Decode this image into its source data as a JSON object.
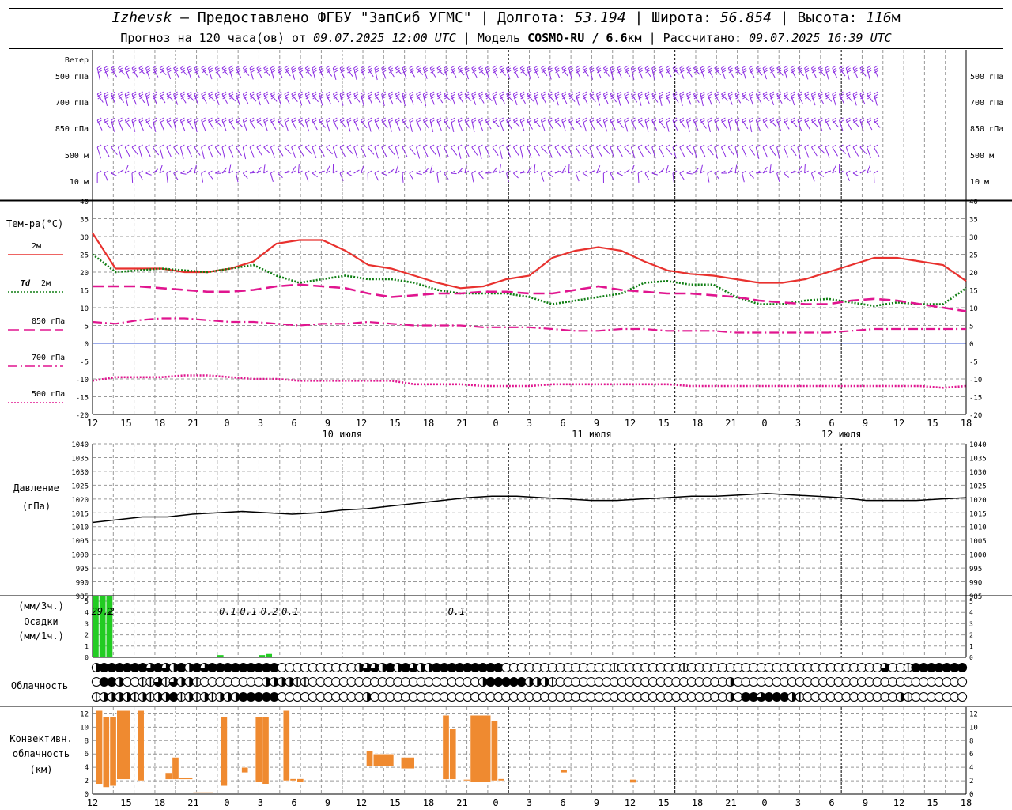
{
  "header": {
    "city": "Izhevsk",
    "provider": " – Предоставлено ФГБУ \"ЗапСиб УГМС\" | Долгота: ",
    "lon": "53.194",
    "lat_label": " | Широта: ",
    "lat": "56.854",
    "alt_label": " | Высота: ",
    "alt": "116",
    "alt_unit": "м",
    "line2_a": "Прогноз на 120 часа(ов) от ",
    "run": "09.07.2025 12:00 UTC",
    "line2_b": " | Модель ",
    "model": "COSMO-RU / 6.6",
    "model_unit": "км",
    "line2_c": " | Рассчитано: ",
    "calc": "09.07.2025 16:39 UTC"
  },
  "chart_data": [
    {
      "type": "wind-barbs",
      "title": "Ветер",
      "levels": [
        "500 гПа",
        "700 гПа",
        "850 гПа",
        "500 м",
        "10 м"
      ]
    },
    {
      "type": "line",
      "title": "Тем-ра(°C)",
      "x_hours_from_start": [
        0,
        3,
        6,
        9,
        12,
        15,
        18,
        21,
        24,
        27,
        30,
        33,
        36,
        39,
        42,
        45,
        48,
        51,
        54,
        57,
        60,
        63,
        66,
        69,
        72,
        75,
        78,
        81,
        84,
        87,
        90,
        93,
        96,
        99,
        102,
        105,
        108,
        111,
        114,
        117,
        120,
        123,
        126
      ],
      "ylim": [
        -20,
        40
      ],
      "yticks": [
        -20,
        -15,
        -10,
        -5,
        0,
        5,
        10,
        15,
        20,
        25,
        30,
        35,
        40
      ],
      "series": [
        {
          "name": "2м",
          "color": "#e8312e",
          "style": "solid",
          "values": [
            31,
            21,
            21,
            21,
            20,
            20,
            21,
            23,
            28,
            29,
            29,
            26,
            22,
            21,
            19,
            17,
            15.5,
            16,
            18,
            19,
            24,
            26,
            27,
            26,
            23,
            20.5,
            19.5,
            19,
            18,
            17,
            17,
            18,
            20,
            22,
            24,
            24,
            23,
            22,
            17.5
          ]
        },
        {
          "name": "Td 2м",
          "color": "#0e7d12",
          "style": "dotted",
          "values": [
            25,
            20,
            20.5,
            21,
            20.5,
            20,
            21,
            22,
            19,
            17,
            18,
            19,
            18,
            18,
            17,
            15,
            14,
            14,
            14,
            13,
            11,
            12,
            13,
            14,
            17,
            17.5,
            16.5,
            16.5,
            13,
            11,
            11,
            12,
            12.5,
            11.5,
            10.5,
            11.5,
            11,
            11,
            15.5
          ]
        },
        {
          "name": "850 гПа",
          "color": "#e0158f",
          "style": "long-dash",
          "values": [
            16,
            16,
            16,
            15.5,
            15,
            14.5,
            14.5,
            15,
            16,
            16.5,
            16,
            15.5,
            14,
            13,
            13.5,
            14,
            14,
            14.5,
            14.5,
            14,
            14,
            15,
            16,
            15,
            14.5,
            14,
            14,
            13.5,
            13,
            12,
            11.5,
            11,
            11,
            12,
            12.5,
            12,
            11,
            10,
            9
          ]
        },
        {
          "name": "700 гПа",
          "color": "#e0158f",
          "style": "dash-dot",
          "values": [
            6,
            5.5,
            6.5,
            7,
            7,
            6.5,
            6,
            6,
            5.5,
            5,
            5.5,
            5.5,
            6,
            5.5,
            5,
            5,
            5,
            4.5,
            4.5,
            4.5,
            4,
            3.5,
            3.5,
            4,
            4,
            3.5,
            3.5,
            3.5,
            3,
            3,
            3,
            3,
            3,
            3.5,
            4,
            4,
            4,
            4,
            4
          ]
        },
        {
          "name": "500 гПа",
          "color": "#e0158f",
          "style": "dotted",
          "values": [
            -10.5,
            -9.5,
            -9.5,
            -9.5,
            -9,
            -9,
            -9.5,
            -10,
            -10,
            -10.5,
            -10.5,
            -10.5,
            -10.5,
            -10.5,
            -11.5,
            -11.5,
            -11.5,
            -12,
            -12,
            -12,
            -11.5,
            -11.5,
            -11.5,
            -11.5,
            -11.5,
            -11.5,
            -12,
            -12,
            -12,
            -12,
            -12,
            -12,
            -12,
            -12,
            -12,
            -12,
            -12,
            -12.5,
            -12
          ]
        }
      ]
    },
    {
      "type": "line",
      "title": "Давление",
      "ylabel": "(гПа)",
      "ylim": [
        985,
        1040
      ],
      "yticks": [
        985,
        990,
        995,
        1000,
        1005,
        1010,
        1015,
        1020,
        1025,
        1030,
        1035,
        1040
      ],
      "series": [
        {
          "name": "Давление",
          "color": "#000000",
          "values": [
            1011.5,
            1012.5,
            1013.5,
            1013.5,
            1014.5,
            1015,
            1015.5,
            1015,
            1014.5,
            1015,
            1016,
            1016.5,
            1017.5,
            1018.5,
            1019.5,
            1020.5,
            1021,
            1021,
            1020.5,
            1020,
            1019.5,
            1019.5,
            1020,
            1020.5,
            1021,
            1021,
            1021.5,
            1022,
            1021.5,
            1021,
            1020.5,
            1019.5,
            1019.5,
            1019.5,
            1020,
            1020.5
          ]
        }
      ]
    },
    {
      "type": "bar",
      "title": "Осадки",
      "ylabels": [
        "(мм/3ч.)",
        "Осадки",
        "(мм/1ч.)"
      ],
      "ylim": [
        0,
        5
      ],
      "yticks": [
        0,
        1,
        2,
        3,
        4,
        5
      ],
      "annotations": [
        {
          "hour": 1.5,
          "text": "29.2"
        },
        {
          "hour": 2.5,
          "text": "2"
        },
        {
          "hour": 19.5,
          "text": "0.1"
        },
        {
          "hour": 22.5,
          "text": "0.1"
        },
        {
          "hour": 25.5,
          "text": "0.2"
        },
        {
          "hour": 28.5,
          "text": "0.1"
        },
        {
          "hour": 52.5,
          "text": "0.1"
        }
      ],
      "bars": [
        {
          "start": 0,
          "end": 1,
          "value": 5.8
        },
        {
          "start": 1,
          "end": 2,
          "value": 5.8
        },
        {
          "start": 2,
          "end": 3,
          "value": 5.8
        },
        {
          "start": 18,
          "end": 19,
          "value": 0.2
        },
        {
          "start": 24,
          "end": 25,
          "value": 0.2
        },
        {
          "start": 25,
          "end": 26,
          "value": 0.3
        },
        {
          "start": 27,
          "end": 28,
          "value": 0.05
        },
        {
          "start": 51,
          "end": 52,
          "value": 0.05
        }
      ]
    },
    {
      "type": "cloud-cover",
      "title": "Облачность",
      "legend": "0 = clear … 8 = overcast; rows: high, middle, low",
      "rows": [
        [
          4,
          8,
          8,
          8,
          8,
          8,
          8,
          6,
          8,
          6,
          4,
          8,
          4,
          8,
          6,
          8,
          8,
          8,
          8,
          8,
          8,
          8,
          8,
          8,
          0,
          0,
          0,
          0,
          0,
          0,
          0,
          0,
          0,
          0,
          4,
          6,
          6,
          4,
          8,
          4,
          8,
          6,
          4,
          4,
          8,
          8,
          8,
          8,
          8,
          8,
          8,
          8,
          8,
          0,
          0,
          0,
          0,
          0,
          0,
          0,
          0,
          0,
          0,
          0,
          0,
          0,
          0,
          2,
          0,
          0,
          0,
          0,
          0,
          0,
          0,
          0,
          2,
          0,
          0,
          0,
          0,
          0,
          0,
          0,
          0,
          0,
          0,
          0,
          0,
          0,
          0,
          0,
          0,
          0,
          0,
          0,
          0,
          0,
          0,
          0,
          0,
          0,
          6,
          0,
          0,
          2,
          8,
          8,
          8,
          8,
          8,
          8,
          8,
          8,
          8,
          8,
          8,
          8,
          2
        ],
        [
          0,
          8,
          8,
          4,
          0,
          0,
          2,
          2,
          6,
          2,
          6,
          4,
          4,
          2,
          0,
          0,
          0,
          0,
          0,
          0,
          0,
          0,
          4,
          4,
          4,
          4,
          2,
          2,
          0,
          0,
          0,
          0,
          0,
          0,
          0,
          0,
          0,
          0,
          0,
          0,
          0,
          0,
          0,
          0,
          0,
          0,
          0,
          0,
          0,
          0,
          4,
          8,
          8,
          8,
          8,
          8,
          4,
          4,
          4,
          2,
          0,
          0,
          0,
          0,
          0,
          0,
          0,
          0,
          0,
          0,
          0,
          0,
          0,
          0,
          0,
          0,
          0,
          0,
          0,
          0,
          0,
          0,
          4,
          0,
          0,
          0,
          0,
          0,
          0,
          0,
          0,
          0,
          0,
          0,
          0,
          0,
          0,
          0,
          0,
          0,
          0,
          0,
          0,
          0,
          0,
          0,
          0,
          0,
          0,
          0,
          0,
          0,
          0,
          0,
          0,
          0,
          0,
          0,
          0
        ],
        [
          2,
          4,
          4,
          4,
          4,
          2,
          4,
          2,
          4,
          4,
          8,
          2,
          4,
          2,
          4,
          2,
          4,
          4,
          4,
          8,
          8,
          8,
          8,
          8,
          0,
          0,
          0,
          0,
          0,
          0,
          0,
          0,
          0,
          0,
          0,
          4,
          0,
          0,
          0,
          0,
          0,
          0,
          0,
          0,
          0,
          0,
          0,
          0,
          0,
          0,
          0,
          0,
          0,
          0,
          0,
          0,
          0,
          0,
          0,
          0,
          0,
          0,
          0,
          0,
          0,
          0,
          0,
          0,
          0,
          0,
          0,
          0,
          0,
          0,
          0,
          0,
          0,
          0,
          0,
          0,
          0,
          0,
          4,
          0,
          8,
          8,
          6,
          8,
          8,
          8,
          4,
          2,
          0,
          0,
          0,
          0,
          0,
          0,
          0,
          0,
          0,
          0,
          0,
          0,
          4,
          2,
          0,
          0,
          0,
          0,
          0,
          0,
          0,
          0,
          0,
          0,
          0,
          0,
          0
        ]
      ]
    },
    {
      "type": "bar",
      "title": "Конвективн. облачность",
      "ylabels": [
        "Конвективн.",
        "облачность",
        "(км)"
      ],
      "ylim": [
        0,
        13
      ],
      "yticks": [
        0,
        2,
        4,
        6,
        8,
        10,
        12
      ],
      "bars": [
        {
          "start": 0.5,
          "end": 1.5,
          "bottom": 1.5,
          "top": 12.5
        },
        {
          "start": 1.5,
          "end": 2.5,
          "bottom": 1,
          "top": 11.5
        },
        {
          "start": 2.5,
          "end": 3.5,
          "bottom": 1.2,
          "top": 11.5
        },
        {
          "start": 3.5,
          "end": 5.5,
          "bottom": 2.2,
          "top": 12.5
        },
        {
          "start": 6.5,
          "end": 7.5,
          "bottom": 2,
          "top": 12.5
        },
        {
          "start": 10.5,
          "end": 11.5,
          "bottom": 2.2,
          "top": 3.2
        },
        {
          "start": 11.5,
          "end": 12.5,
          "bottom": 2.2,
          "top": 5.5
        },
        {
          "start": 12.5,
          "end": 14.5,
          "bottom": 2.2,
          "top": 2.5
        },
        {
          "start": 14.5,
          "end": 17.5,
          "bottom": 0.2,
          "top": 0.3
        },
        {
          "start": 18.5,
          "end": 19.5,
          "bottom": 1.2,
          "top": 11.5
        },
        {
          "start": 21.5,
          "end": 22.5,
          "bottom": 3.2,
          "top": 4
        },
        {
          "start": 23.5,
          "end": 24.5,
          "bottom": 1.8,
          "top": 11.5
        },
        {
          "start": 24.5,
          "end": 25.5,
          "bottom": 1.5,
          "top": 11.5
        },
        {
          "start": 27.5,
          "end": 28.5,
          "bottom": 2,
          "top": 12.5
        },
        {
          "start": 28.5,
          "end": 29.5,
          "bottom": 2,
          "top": 2.3
        },
        {
          "start": 29.5,
          "end": 30.5,
          "bottom": 1.8,
          "top": 2.3
        },
        {
          "start": 39.5,
          "end": 40.5,
          "bottom": 4.2,
          "top": 6.5
        },
        {
          "start": 40.5,
          "end": 43.5,
          "bottom": 4.2,
          "top": 6
        },
        {
          "start": 44.5,
          "end": 46.5,
          "bottom": 3.8,
          "top": 5.5
        },
        {
          "start": 50.5,
          "end": 51.5,
          "bottom": 2.2,
          "top": 11.8
        },
        {
          "start": 51.5,
          "end": 52.5,
          "bottom": 2.2,
          "top": 9.8
        },
        {
          "start": 53.5,
          "end": 54.5,
          "bottom": 2,
          "top": 2.2
        },
        {
          "start": 54.5,
          "end": 57.5,
          "bottom": 1.8,
          "top": 11.8
        },
        {
          "start": 57.5,
          "end": 58.5,
          "bottom": 2,
          "top": 11
        },
        {
          "start": 58.5,
          "end": 59.5,
          "bottom": 2,
          "top": 2.3
        },
        {
          "start": 67.5,
          "end": 68.5,
          "bottom": 3.2,
          "top": 3.7
        },
        {
          "start": 77.5,
          "end": 78.5,
          "bottom": 1.7,
          "top": 2.2
        }
      ]
    }
  ],
  "axis": {
    "hour_ticks": [
      "12",
      "15",
      "18",
      "21",
      "0",
      "3",
      "6",
      "9",
      "12",
      "15",
      "18",
      "21",
      "0",
      "3",
      "6",
      "9",
      "12",
      "15",
      "18",
      "21",
      "0",
      "3",
      "6",
      "9",
      "12",
      "15",
      "18"
    ],
    "days": [
      "10 июля",
      "11 июля",
      "12 июля"
    ]
  },
  "legend_labels": {
    "t2m": "2м",
    "td_prefix": "Td",
    "td_suffix": "2м",
    "t850": "850 гПа",
    "t700": "700 гПа",
    "t500": "500 гПа"
  },
  "colors": {
    "wind": "#8a2be2",
    "precip": "#22cc22",
    "conv": "#ef8a30",
    "grid": "#999999",
    "zero_line": "#3a57d6"
  }
}
